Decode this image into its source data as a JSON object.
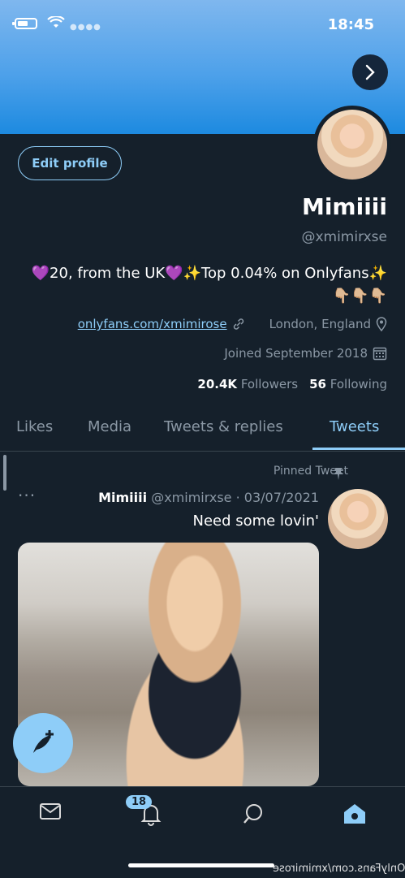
{
  "status": {
    "time": "18:45"
  },
  "profile": {
    "edit_label": "Edit profile",
    "name": "Mimiiii",
    "handle": "@xmimirxse",
    "bio": "💜20, from the UK💜✨Top 0.04% on Onlyfans✨ 👇🏼👇🏼👇🏼",
    "location": "London, England",
    "link": "onlyfans.com/xmimirose",
    "joined": "Joined September 2018",
    "following_count": "56",
    "following_label": "Following",
    "followers_count": "20.4K",
    "followers_label": "Followers"
  },
  "tabs": [
    "Tweets",
    "Tweets & replies",
    "Media",
    "Likes"
  ],
  "tweet": {
    "pinned_label": "Pinned Tweet",
    "author": "Mimiiii",
    "meta": "@xmimirxse · 03/07/2021",
    "more": "···",
    "text": "Need some lovin'"
  },
  "nav": {
    "notifications_badge": "18"
  },
  "watermark": "OnlyFans.com/xmimirose",
  "colors": {
    "accent": "#8ecdf8",
    "background": "#15202b",
    "secondary_text": "#8b98a5"
  }
}
